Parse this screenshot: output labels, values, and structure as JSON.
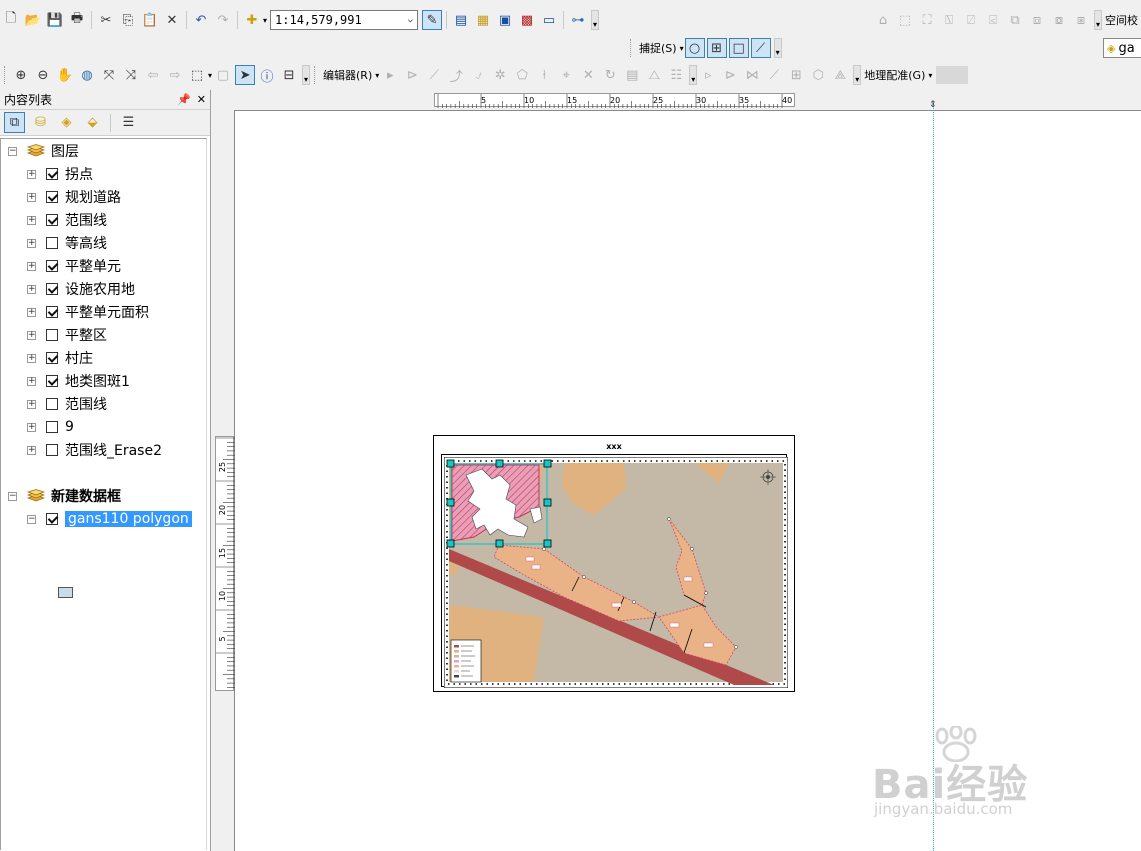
{
  "toolbar": {
    "map_scale": "1:14,579,991",
    "snapping_label": "捕捉(S)",
    "editor_label": "编辑器(R)",
    "georeferencing_label": "地理配准(G)",
    "spatial_adjust_label": "空间校",
    "layer_dropdown_value": "ga"
  },
  "toc": {
    "title": "内容列表",
    "groups": [
      {
        "name": "图层",
        "layers": [
          {
            "label": "拐点",
            "checked": true
          },
          {
            "label": "规划道路",
            "checked": true
          },
          {
            "label": "范围线",
            "checked": true
          },
          {
            "label": "等高线",
            "checked": false
          },
          {
            "label": "平整单元",
            "checked": true
          },
          {
            "label": "设施农用地",
            "checked": true
          },
          {
            "label": "平整单元面积",
            "checked": true
          },
          {
            "label": "平整区",
            "checked": false
          },
          {
            "label": "村庄",
            "checked": true
          },
          {
            "label": "地类图斑1",
            "checked": true
          },
          {
            "label": "范围线",
            "checked": false
          },
          {
            "label": "9",
            "checked": false
          },
          {
            "label": "范围线_Erase2",
            "checked": false
          }
        ]
      },
      {
        "name": "新建数据框",
        "layers": [
          {
            "label": "gans110 polygon",
            "checked": true,
            "selected": true
          }
        ]
      }
    ]
  },
  "ruler": {
    "h_ticks": [
      "5",
      "10",
      "15",
      "20",
      "25",
      "30",
      "35",
      "40"
    ],
    "v_ticks": [
      "25",
      "20",
      "15",
      "10",
      "5"
    ]
  },
  "layout": {
    "page_title": "xxx"
  },
  "watermark": {
    "main": "Bai经验",
    "sub": "jingyan.baidu.com"
  },
  "colors": {
    "selection": "#3399ff",
    "guide": "#3aaee0",
    "map_background": "#c4b9a6",
    "land_parcel": "#dfb27f",
    "road": "#b04a4a",
    "village": "#d85a7a",
    "handle": "#18c6c6"
  }
}
